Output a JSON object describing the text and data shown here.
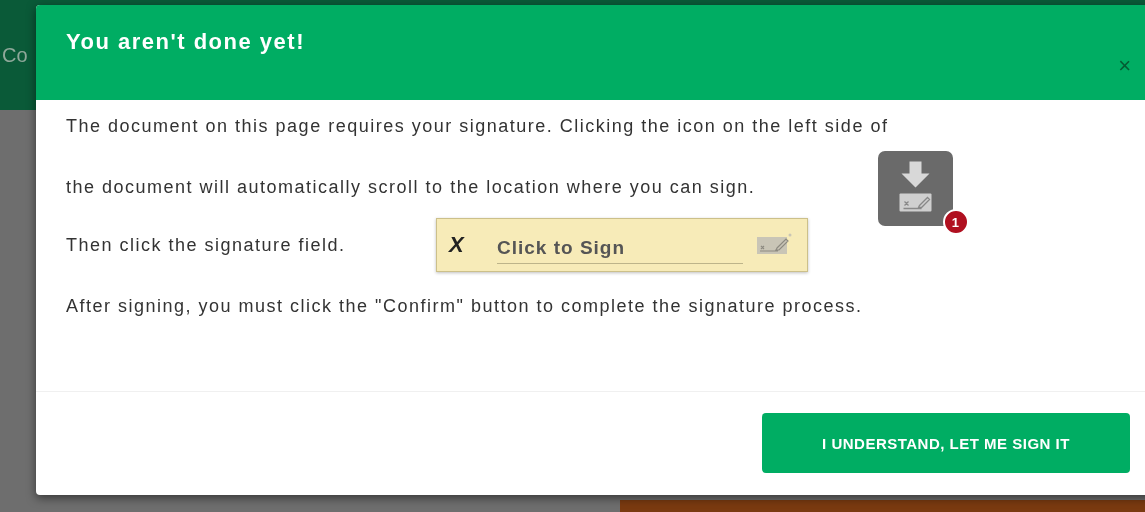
{
  "background": {
    "header_text": "Co"
  },
  "dialog": {
    "title": "You aren't done yet!",
    "close": "×",
    "intro": "The document on this page requires your signature. Clicking the icon on the left side of the document will automatically scroll to the location where you can sign.",
    "badge": "1",
    "field_instruction": "Then click the signature field.",
    "signature_field": {
      "mark": "X",
      "label": "Click to Sign"
    },
    "after": "After signing, you must click the \"Confirm\" button to complete the signature process.",
    "button": "I UNDERSTAND, LET ME SIGN IT"
  }
}
